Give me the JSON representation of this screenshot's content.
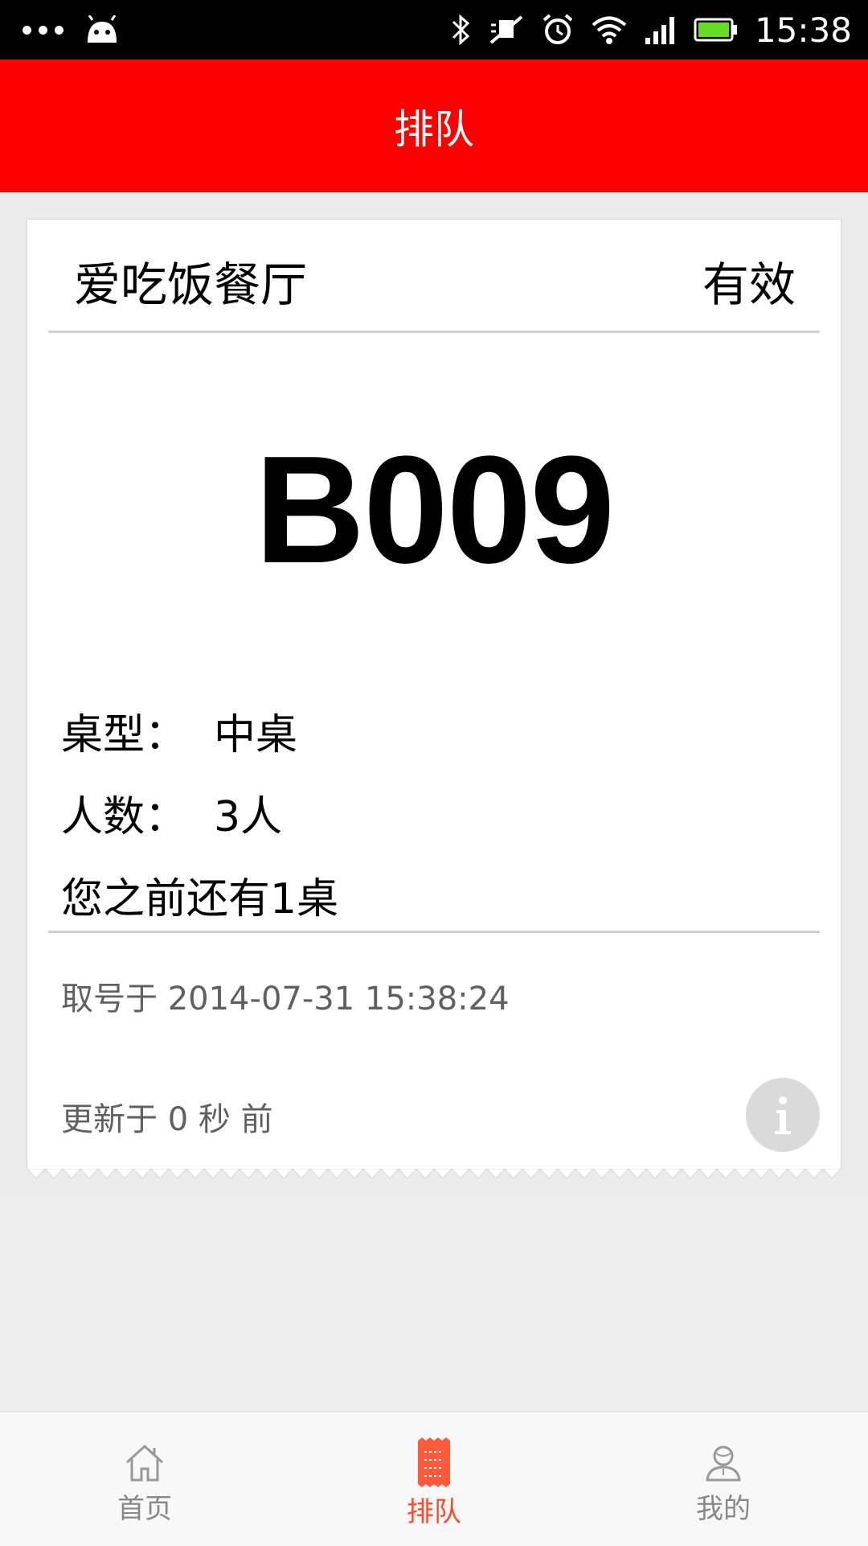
{
  "status_bar": {
    "time": "15:38",
    "icons": [
      "more-dots-icon",
      "android-icon",
      "bluetooth-icon",
      "mute-icon",
      "alarm-icon",
      "wifi-icon",
      "signal-icon",
      "battery-icon"
    ]
  },
  "app_bar": {
    "title": "排队",
    "color": "#ff0000"
  },
  "ticket": {
    "restaurant_name": "爱吃饭餐厅",
    "status": "有效",
    "queue_number": "B009",
    "table_type_label": "桌型：",
    "table_type_value": "中桌",
    "people_label": "人数：",
    "people_value": "3人",
    "tables_ahead_text": "您之前还有1桌",
    "taken_at_text": "取号于 2014-07-31 15:38:24",
    "updated_text": "更新于 0 秒 前",
    "info_icon": "info-icon"
  },
  "bottom_nav": {
    "items": [
      {
        "label": "首页",
        "icon": "home-icon",
        "active": false
      },
      {
        "label": "排队",
        "icon": "queue-ticket-icon",
        "active": true
      },
      {
        "label": "我的",
        "icon": "user-icon",
        "active": false
      }
    ],
    "active_color": "#ff4a2a",
    "inactive_color": "#888888"
  }
}
